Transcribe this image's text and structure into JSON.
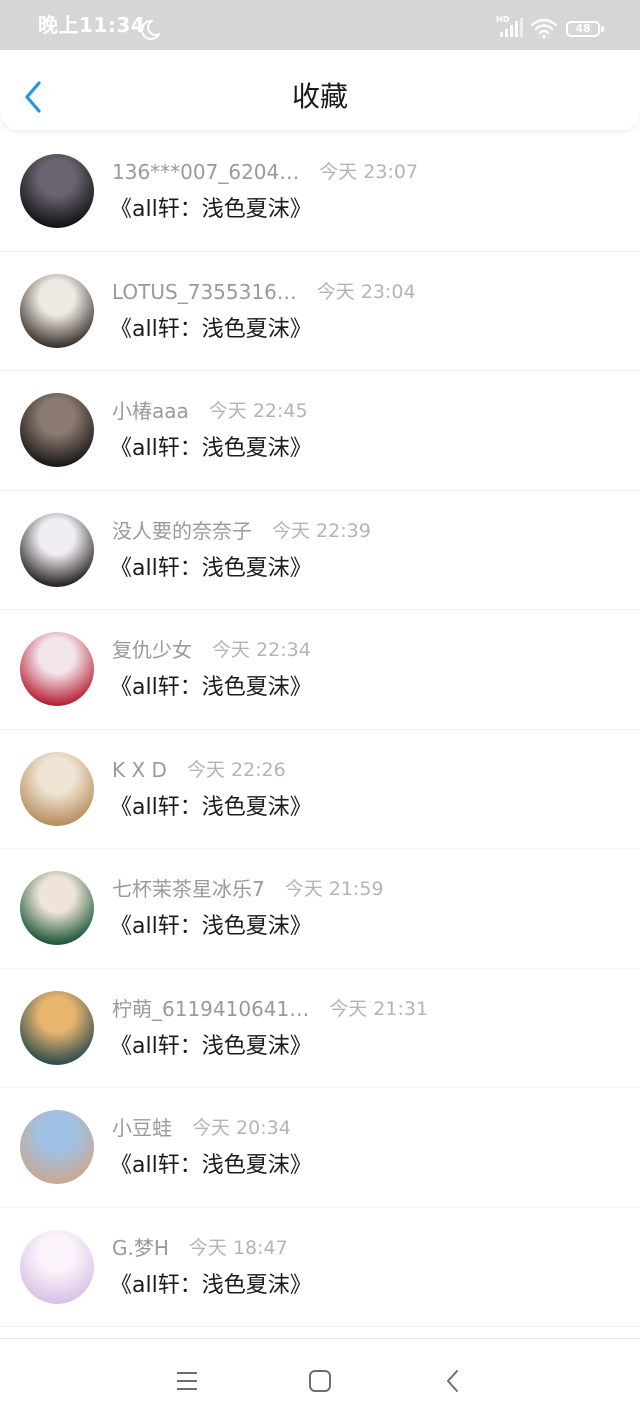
{
  "status_bar": {
    "time": "晚上11:34",
    "network_label": "HD",
    "battery_level": "48",
    "icons": [
      "moon-icon",
      "signal-icon",
      "wifi-icon",
      "battery-icon"
    ]
  },
  "header": {
    "title": "收藏",
    "back_icon": "chevron-left-icon"
  },
  "colors": {
    "accent": "#2196e8",
    "status_bar_bg": "#d6d6d6",
    "name_text": "#9a9a9a",
    "time_text": "#b4b4b4",
    "title_text": "#1c1c1c"
  },
  "favorites": [
    {
      "name": "136***007_6204…",
      "time": "今天 23:07",
      "title": "《all轩：浅色夏沫》",
      "avatar_colors": [
        "#6b6470",
        "#141416"
      ]
    },
    {
      "name": "LOTUS_7355316…",
      "time": "今天 23:04",
      "title": "《all轩：浅色夏沫》",
      "avatar_colors": [
        "#efe9e4",
        "#3c3530"
      ]
    },
    {
      "name": "小椿aaa",
      "time": "今天 22:45",
      "title": "《all轩：浅色夏沫》",
      "avatar_colors": [
        "#8a7a70",
        "#1e1a18"
      ]
    },
    {
      "name": "没人要的奈奈子",
      "time": "今天 22:39",
      "title": "《all轩：浅色夏沫》",
      "avatar_colors": [
        "#f1eef3",
        "#2a2628"
      ]
    },
    {
      "name": "复仇少女",
      "time": "今天 22:34",
      "title": "《all轩：浅色夏沫》",
      "avatar_colors": [
        "#f3e6ea",
        "#b8233a"
      ]
    },
    {
      "name": "K X D",
      "time": "今天 22:26",
      "title": "《all轩：浅色夏沫》",
      "avatar_colors": [
        "#f0e4d4",
        "#b88f5e"
      ]
    },
    {
      "name": "七杯茉茶星冰乐7",
      "time": "今天 21:59",
      "title": "《all轩：浅色夏沫》",
      "avatar_colors": [
        "#efe4d8",
        "#1f5a3a"
      ]
    },
    {
      "name": "柠萌_6119410641…",
      "time": "今天 21:31",
      "title": "《all轩：浅色夏沫》",
      "avatar_colors": [
        "#e9b56e",
        "#2f4f4f"
      ]
    },
    {
      "name": "小豆蛙",
      "time": "今天 20:34",
      "title": "《all轩：浅色夏沫》",
      "avatar_colors": [
        "#9fc2e4",
        "#c9a893"
      ]
    },
    {
      "name": "G.梦H",
      "time": "今天 18:47",
      "title": "《all轩：浅色夏沫》",
      "avatar_colors": [
        "#fbf3fb",
        "#d9c2e6"
      ]
    }
  ],
  "nav_bar": {
    "icons": [
      "menu-icon",
      "home-icon",
      "back-icon"
    ]
  }
}
